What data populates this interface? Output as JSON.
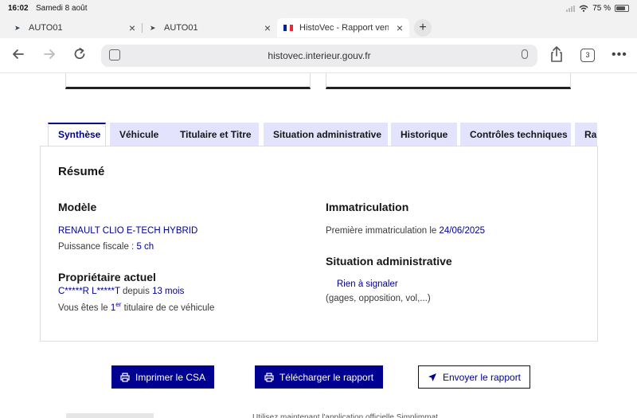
{
  "status": {
    "time": "16:02",
    "date": "Samedi 8 août",
    "battery": "75 %",
    "battery_level": 0.75
  },
  "browser": {
    "tabs": [
      {
        "title": "AUTO01"
      },
      {
        "title": "AUTO01"
      },
      {
        "title": "HistoVec - Rapport vend"
      }
    ],
    "new_tab": "+",
    "url": "histovec.interieur.gouv.fr",
    "tab_count": "3",
    "more": "•••"
  },
  "nav_tabs": [
    "Synthèse",
    "Véhicule",
    "Titulaire et Titre",
    "Situation administrative",
    "Historique",
    "Contrôles techniques",
    "Ra"
  ],
  "panel": {
    "title": "Résumé",
    "modele": {
      "heading": "Modèle",
      "name": "RENAULT CLIO E-TECH HYBRID",
      "puissance_label": "Puissance fiscale : ",
      "puissance_value": "5 ch"
    },
    "proprietaire": {
      "heading": "Propriétaire actuel",
      "name": "C*****R L*****T",
      "depuis_label": " depuis ",
      "depuis_value": "13 mois",
      "titulaire_prefix": "Vous êtes le ",
      "titulaire_num": "1",
      "titulaire_sup": "er",
      "titulaire_suffix": " titulaire de ce véhicule"
    },
    "immatriculation": {
      "heading": "Immatriculation",
      "label": "Première immatriculation le ",
      "date": "24/06/2025"
    },
    "situation": {
      "heading": "Situation administrative",
      "status": "Rien à signaler",
      "detail": "(gages, opposition, vol,...)"
    }
  },
  "actions": {
    "print": "Imprimer le CSA",
    "download": "Télécharger le rapport",
    "send": "Envoyer le rapport"
  },
  "footer_partial": "Utilisez maintenant l'application officielle Simplimmat"
}
